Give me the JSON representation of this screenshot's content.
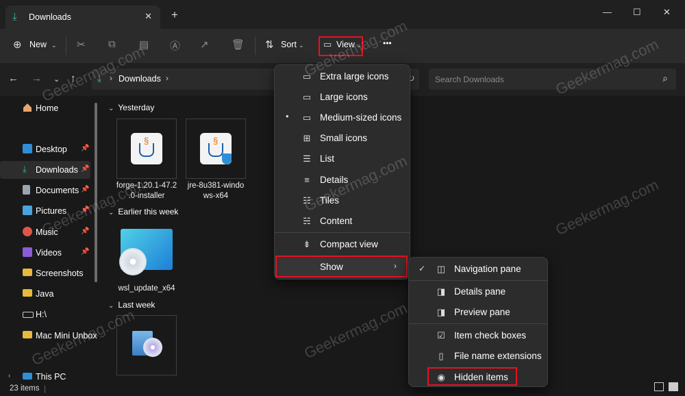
{
  "window": {
    "tab_title": "Downloads",
    "new_tab": "+",
    "minimize": "—",
    "maximize": "☐",
    "close": "✕",
    "tab_close": "✕"
  },
  "toolbar": {
    "new_label": "New",
    "sort_label": "Sort",
    "view_label": "View",
    "more_label": "•••"
  },
  "nav": {
    "breadcrumb": "Downloads",
    "search_placeholder": "Search Downloads"
  },
  "sidebar": {
    "items": [
      {
        "label": "Home",
        "icon": "home-icon",
        "pinned": false
      },
      {
        "label": "Desktop",
        "icon": "desktop-icon",
        "pinned": true
      },
      {
        "label": "Downloads",
        "icon": "download-icon",
        "pinned": true
      },
      {
        "label": "Documents",
        "icon": "documents-icon",
        "pinned": true
      },
      {
        "label": "Pictures",
        "icon": "pictures-icon",
        "pinned": true
      },
      {
        "label": "Music",
        "icon": "music-icon",
        "pinned": true
      },
      {
        "label": "Videos",
        "icon": "videos-icon",
        "pinned": true
      },
      {
        "label": "Screenshots",
        "icon": "folder-icon",
        "pinned": false
      },
      {
        "label": "Java",
        "icon": "folder-icon",
        "pinned": false
      },
      {
        "label": "H:\\",
        "icon": "drive-icon",
        "pinned": false
      },
      {
        "label": "Mac Mini Unbox",
        "icon": "folder-icon",
        "pinned": false
      },
      {
        "label": "This PC",
        "icon": "pc-icon",
        "pinned": false
      }
    ]
  },
  "groups": {
    "yesterday": "Yesterday",
    "earlier_week": "Earlier this week",
    "last_week": "Last week"
  },
  "files": {
    "forge_line1": "forge-1.20.1-47.2",
    "forge_line2": ".0-installer",
    "jre_line1": "jre-8u381-windo",
    "jre_line2": "ws-x64",
    "wsl": "wsl_update_x64"
  },
  "status": {
    "count": "23 items"
  },
  "view_menu": {
    "items": [
      {
        "label": "Extra large icons",
        "icon": "monitor-icon",
        "selected": false
      },
      {
        "label": "Large icons",
        "icon": "monitor-icon",
        "selected": false
      },
      {
        "label": "Medium-sized icons",
        "icon": "monitor-icon",
        "selected": true
      },
      {
        "label": "Small icons",
        "icon": "grid-icon",
        "selected": false
      },
      {
        "label": "List",
        "icon": "list-icon",
        "selected": false
      },
      {
        "label": "Details",
        "icon": "details-icon",
        "selected": false
      },
      {
        "label": "Tiles",
        "icon": "tiles-icon",
        "selected": false
      },
      {
        "label": "Content",
        "icon": "content-icon",
        "selected": false
      },
      {
        "label": "Compact view",
        "icon": "compact-icon",
        "selected": false
      },
      {
        "label": "Show",
        "icon": "",
        "selected": false
      }
    ]
  },
  "show_menu": {
    "items": [
      {
        "label": "Navigation pane",
        "icon": "pane-icon",
        "checked": true
      },
      {
        "label": "Details pane",
        "icon": "pane-icon",
        "checked": false
      },
      {
        "label": "Preview pane",
        "icon": "pane-icon",
        "checked": false
      },
      {
        "label": "Item check boxes",
        "icon": "checkbox-icon",
        "checked": false
      },
      {
        "label": "File name extensions",
        "icon": "file-icon",
        "checked": false
      },
      {
        "label": "Hidden items",
        "icon": "eye-icon",
        "checked": false
      }
    ]
  },
  "watermark": "Geekermag.com",
  "colors": {
    "accent": "#3ab6a8",
    "highlight_border": "#e81123"
  }
}
